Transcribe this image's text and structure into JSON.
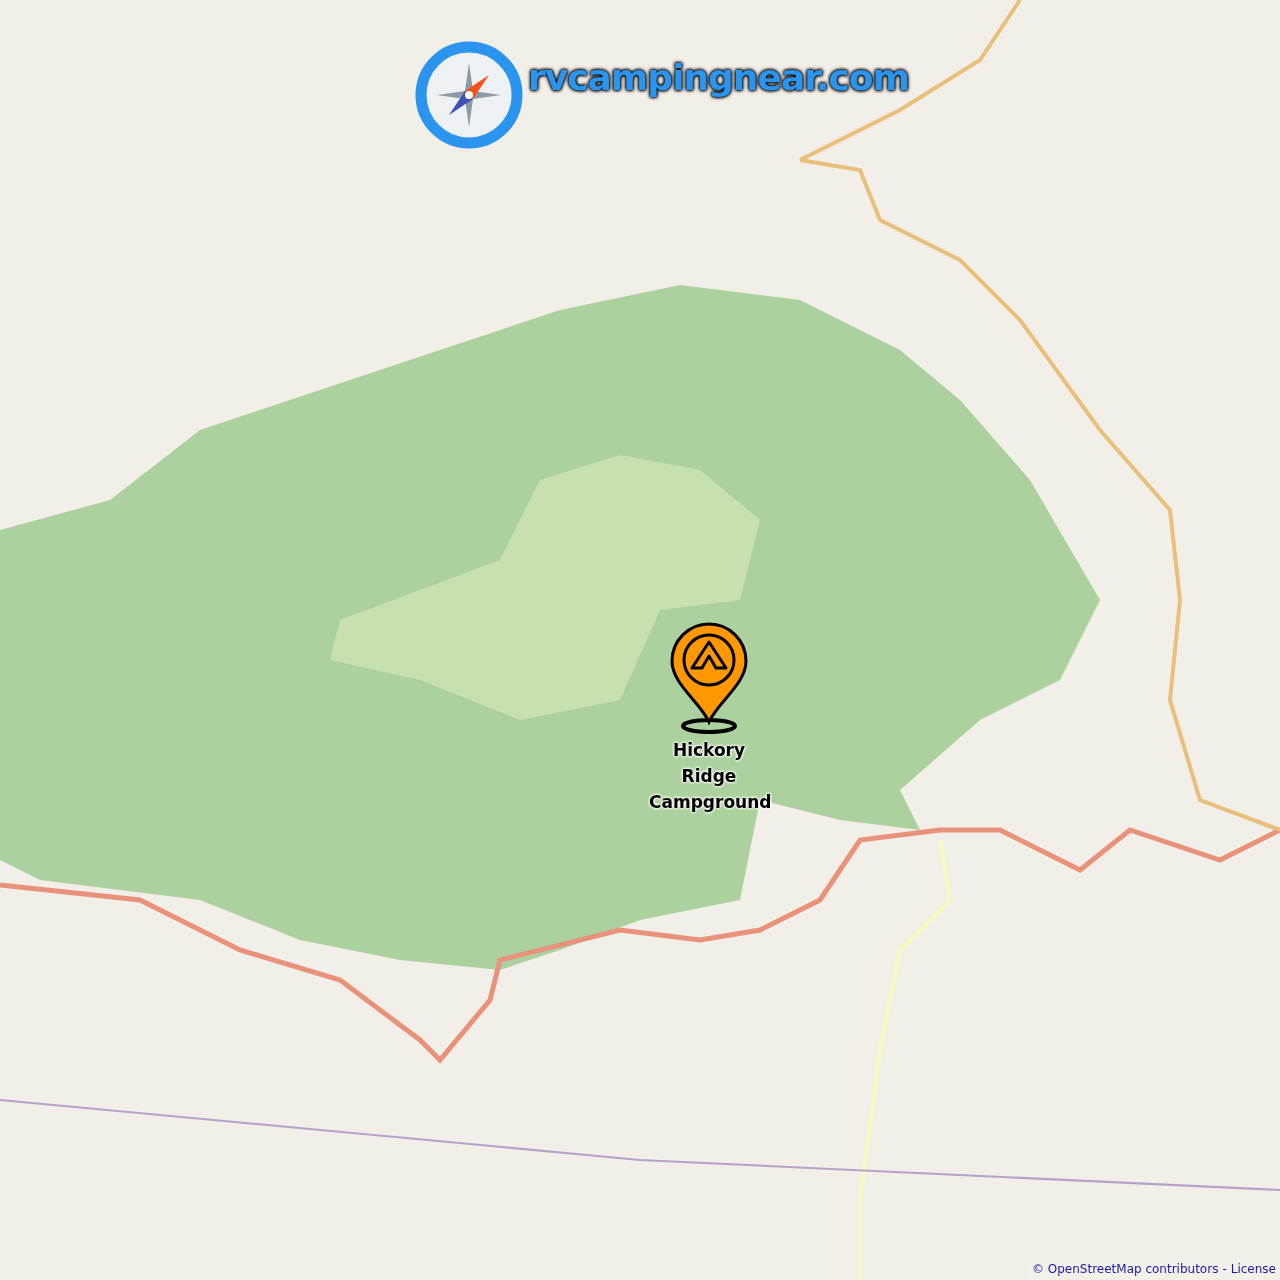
{
  "logo": {
    "text": "rvcampingnear.com"
  },
  "marker": {
    "label": "Hickory Ridge Campground"
  },
  "attribution": {
    "text": "© OpenStreetMap contributors",
    "separator": "-",
    "link": "License"
  }
}
